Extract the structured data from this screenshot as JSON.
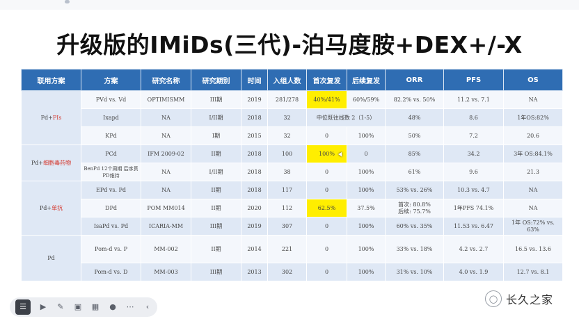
{
  "title": "升级版的IMiDs(三代)-泊马度胺+DEX+/-X",
  "table": {
    "headers": [
      "联用方案",
      "方案",
      "研究名称",
      "研究期别",
      "时间",
      "入组人数",
      "首次复发",
      "后续复发",
      "ORR",
      "PFS",
      "OS"
    ],
    "groups": [
      {
        "label_a": "Pd+",
        "label_b": "PIs"
      },
      {
        "label_a": "Pd+",
        "label_b": "细胞毒药物"
      },
      {
        "label_a": "Pd+",
        "label_b": "单抗"
      },
      {
        "label_a": "Pd",
        "label_b": ""
      }
    ],
    "rows": [
      [
        "PVd vs. Vd",
        "OPTIMISMM",
        "III期",
        "2019",
        "281/278",
        "40%/41%",
        "60%/59%",
        "82.2% vs. 50%",
        "11.2 vs. 7.1",
        "NA"
      ],
      [
        "Ixapd",
        "NA",
        "I/II期",
        "2018",
        "32",
        "中位既往线数 2（1-5）",
        "",
        "48%",
        "8.6",
        "1年OS:82%"
      ],
      [
        "KPd",
        "NA",
        "I期",
        "2015",
        "32",
        "0",
        "100%",
        "50%",
        "7.2",
        "20.6"
      ],
      [
        "PCd",
        "IFM 2009-02",
        "II期",
        "2018",
        "100",
        "100%",
        "0",
        "85%",
        "34.2",
        "3年 OS:84.1%"
      ],
      [
        "BenPd 12个周期 后序贯PD维持",
        "NA",
        "I/II期",
        "2018",
        "38",
        "0",
        "100%",
        "61%",
        "9.6",
        "21.3"
      ],
      [
        "EPd vs. Pd",
        "NA",
        "II期",
        "2018",
        "117",
        "0",
        "100%",
        "53% vs. 26%",
        "10.3 vs. 4.7",
        "NA"
      ],
      [
        "DPd",
        "POM MM014",
        "II期",
        "2020",
        "112",
        "62.5%",
        "37.5%",
        "首次: 80.8%\n后续: 75.7%",
        "1年PFS 74.1%",
        "NA"
      ],
      [
        "IsaPd vs. Pd",
        "ICARIA-MM",
        "III期",
        "2019",
        "307",
        "0",
        "100%",
        "60% vs. 35%",
        "11.53 vs. 6.47",
        "1年 OS:72% vs. 63%"
      ],
      [
        "Pom-d vs. P",
        "MM-002",
        "II期",
        "2014",
        "221",
        "0",
        "100%",
        "33% vs. 18%",
        "4.2 vs. 2.7",
        "16.5 vs. 13.6"
      ],
      [
        "Pom-d vs. D",
        "MM-003",
        "III期",
        "2013",
        "302",
        "0",
        "100%",
        "31% vs. 10%",
        "4.0 vs. 1.9",
        "12.7 vs. 8.1"
      ]
    ]
  },
  "colors": {
    "header_bg": "#2f6db3",
    "highlight": "#ffee00",
    "accent_red": "#d4382e"
  },
  "toolbar": {
    "icons": [
      "list-icon",
      "play-icon",
      "pen-icon",
      "screenshot-icon",
      "grid-icon",
      "user-icon",
      "more-icon",
      "collapse-icon"
    ]
  },
  "watermark": {
    "text": "长久之家"
  }
}
